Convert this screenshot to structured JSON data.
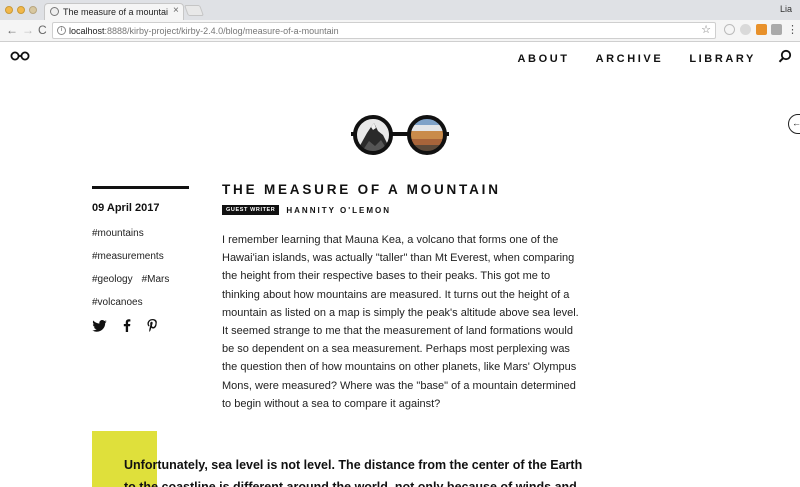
{
  "browser": {
    "tab_title": "The measure of a mountain | C",
    "tab_close": "×",
    "user": "Lia",
    "url_host": "localhost",
    "url_path": ":8888/kirby-project/kirby-2.4.0/blog/measure-of-a-mountain",
    "back": "←",
    "forward": "→",
    "reload": "C",
    "star": "☆",
    "menu": "⋮"
  },
  "site": {
    "nav": [
      "ABOUT",
      "ARCHIVE",
      "LIBRARY"
    ],
    "edge_button": "←"
  },
  "post": {
    "date": "09 April 2017",
    "tags": [
      "#mountains",
      "#measurements",
      "#geology",
      "#Mars",
      "#volcanoes"
    ],
    "title": "THE MEASURE OF A MOUNTAIN",
    "badge": "GUEST WRITER",
    "author": "HANNITY O'LEMON",
    "body": "I remember learning that Mauna Kea, a volcano that forms one of the Hawai'ian islands, was actually \"taller\" than Mt Everest, when comparing the height from their respective bases to their peaks. This got me to thinking about how mountains are measured. It turns out the height of a mountain as listed on a map is simply the peak's altitude above sea level. It seemed strange to me that the measurement of land formations would be so dependent on a sea measurement. Perhaps most perplexing was the question then of how mountains on other planets, like Mars' Olympus Mons, were measured? Where was the \"base\" of a mountain determined to begin without a sea to compare it against?",
    "pullquote": "Unfortunately, sea level is not level. The distance from the center of the Earth to the coastline is different around the world, not only because of winds and"
  },
  "colors": {
    "accent_yellow": "#dfe03b",
    "text": "#111111"
  },
  "icons": [
    "glasses-logo-icon",
    "search-icon",
    "twitter-icon",
    "facebook-icon",
    "pinterest-icon"
  ]
}
